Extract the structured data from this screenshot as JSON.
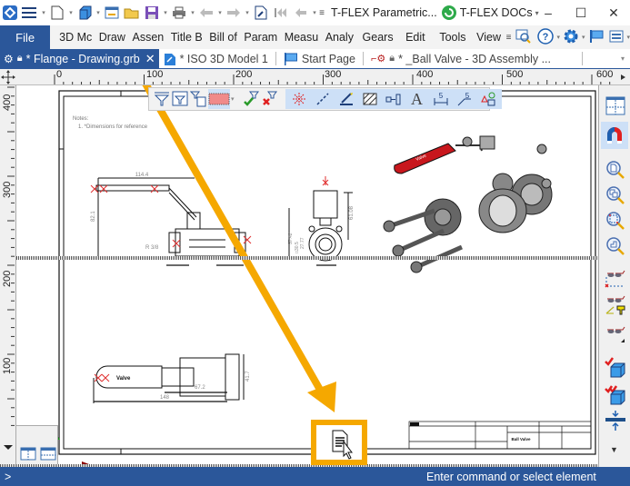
{
  "titlebar": {
    "app_title": "T-FLEX Parametric...",
    "docs_label": "T-FLEX DOCs",
    "minimize": "–",
    "maximize": "☐",
    "close": "✕"
  },
  "menubar": {
    "file_label": "File",
    "items": [
      "3D Mc",
      "Draw",
      "Assen",
      "Title B",
      "Bill of",
      "Param",
      "Measu",
      "Analy",
      "Gears",
      "Edit",
      "Tools",
      "View"
    ]
  },
  "tabs": [
    {
      "label": "* Flange - Drawing.grb",
      "active": true,
      "close": "✕"
    },
    {
      "label": "* ISO 3D Model 1",
      "active": false
    },
    {
      "label": "Start Page",
      "active": false
    },
    {
      "label": "* _Ball Valve - 3D Assembly ...",
      "active": false
    }
  ],
  "rulers": {
    "horizontal_ticks": [
      "0",
      "100",
      "200",
      "300",
      "400",
      "500",
      "600"
    ],
    "vertical_ticks": [
      "400",
      "300",
      "200",
      "100"
    ]
  },
  "drawing": {
    "notes_title": "Notes:",
    "notes_line": "1. *Dimensions for reference",
    "dims": {
      "top_len": "114.4",
      "height_left": "82.1",
      "thread_left": "R 3/8",
      "height_right": "61.08",
      "h_5742": "57.42",
      "h_305": "□30.5",
      "h_277": "27.77",
      "width_24": "24",
      "len_672": "67.2",
      "len_148": "148",
      "h_417": "41.7"
    },
    "title_block_name": "Ball Valve"
  },
  "status": {
    "prompt": ">",
    "message": "Enter command or select element"
  },
  "colors": {
    "accent": "#2b579a",
    "callout": "#f5a800",
    "handle_red": "#c8171d"
  }
}
